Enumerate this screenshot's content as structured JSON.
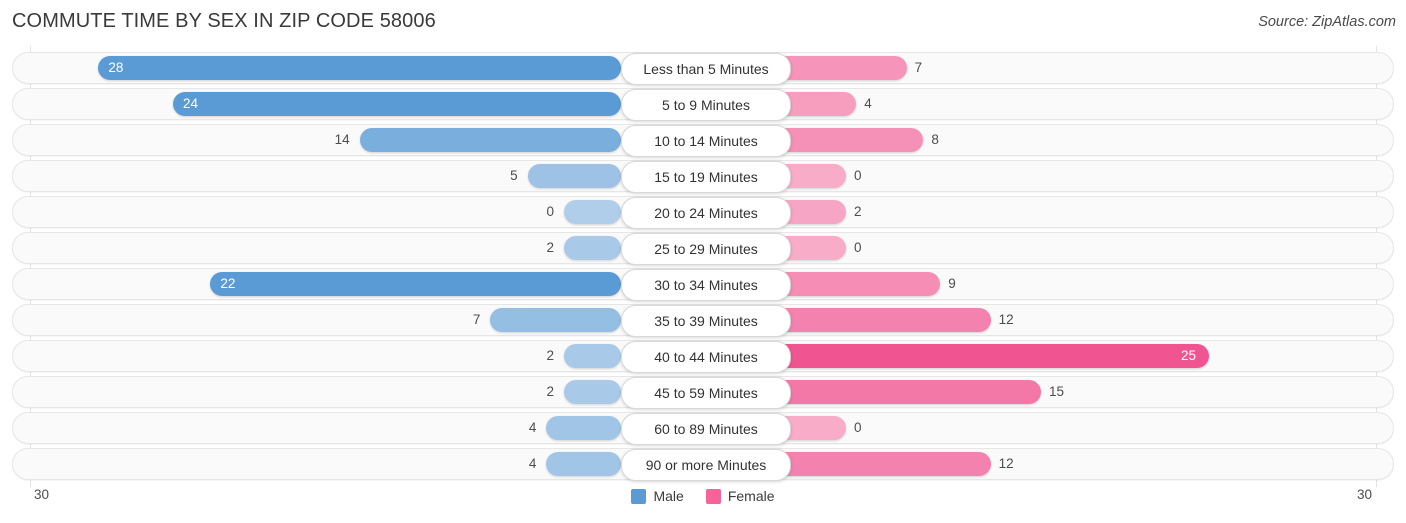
{
  "header": {
    "title": "COMMUTE TIME BY SEX IN ZIP CODE 58006",
    "source": "Source: ZipAtlas.com"
  },
  "legend": {
    "male_label": "Male",
    "female_label": "Female",
    "male_color": "#5b9bd5",
    "female_color": "#f4639a"
  },
  "axis": {
    "left_label": "30",
    "right_label": "30",
    "max": 30
  },
  "chart_data": {
    "type": "bar",
    "subtype": "diverging-bar",
    "title": "COMMUTE TIME BY SEX IN ZIP CODE 58006",
    "xlabel": "",
    "ylabel": "",
    "xlim": [
      30,
      30
    ],
    "grid": false,
    "legend_position": "bottom-center",
    "categories": [
      "Less than 5 Minutes",
      "5 to 9 Minutes",
      "10 to 14 Minutes",
      "15 to 19 Minutes",
      "20 to 24 Minutes",
      "25 to 29 Minutes",
      "30 to 34 Minutes",
      "35 to 39 Minutes",
      "40 to 44 Minutes",
      "45 to 59 Minutes",
      "60 to 89 Minutes",
      "90 or more Minutes"
    ],
    "series": [
      {
        "name": "Male",
        "direction": "left",
        "color": "#5b9bd5",
        "values": [
          28,
          24,
          14,
          5,
          0,
          2,
          22,
          7,
          2,
          2,
          4,
          4
        ]
      },
      {
        "name": "Female",
        "direction": "right",
        "color": "#f4639a",
        "values": [
          7,
          4,
          8,
          0,
          2,
          0,
          9,
          12,
          25,
          15,
          0,
          12
        ]
      }
    ]
  },
  "rows": [
    {
      "label": "Less than 5 Minutes",
      "male": "28",
      "female": "7"
    },
    {
      "label": "5 to 9 Minutes",
      "male": "24",
      "female": "4"
    },
    {
      "label": "10 to 14 Minutes",
      "male": "14",
      "female": "8"
    },
    {
      "label": "15 to 19 Minutes",
      "male": "5",
      "female": "0"
    },
    {
      "label": "20 to 24 Minutes",
      "male": "0",
      "female": "2"
    },
    {
      "label": "25 to 29 Minutes",
      "male": "2",
      "female": "0"
    },
    {
      "label": "30 to 34 Minutes",
      "male": "22",
      "female": "9"
    },
    {
      "label": "35 to 39 Minutes",
      "male": "7",
      "female": "12"
    },
    {
      "label": "40 to 44 Minutes",
      "male": "2",
      "female": "25"
    },
    {
      "label": "45 to 59 Minutes",
      "male": "2",
      "female": "15"
    },
    {
      "label": "60 to 89 Minutes",
      "male": "4",
      "female": "0"
    },
    {
      "label": "90 or more Minutes",
      "male": "4",
      "female": "12"
    }
  ]
}
